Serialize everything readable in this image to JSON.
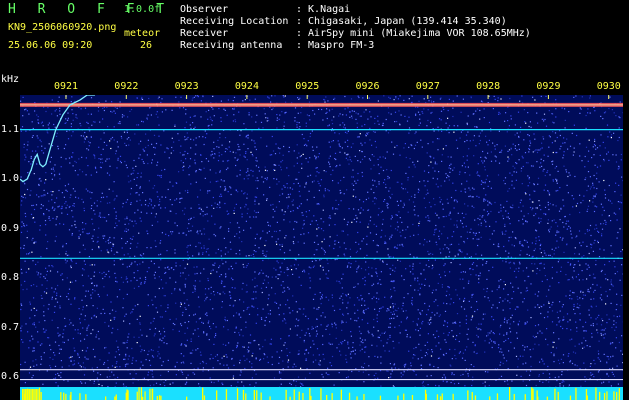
{
  "header": {
    "brand": "H R O F F T",
    "version": "1.0.0f",
    "filename": "KN9_2506060920.png",
    "datetime": "25.06.06 09:20",
    "meteor_label": "meteor",
    "meteor_count": "26",
    "fields": [
      {
        "label": "Observer",
        "value": ": K.Nagai"
      },
      {
        "label": "Receiving Location",
        "value": ": Chigasaki, Japan (139.414 35.340)"
      },
      {
        "label": "Receiver",
        "value": ": AirSpy mini (Miakejima VOR 108.65MHz)"
      },
      {
        "label": "Receiving antenna",
        "value": ": Maspro FM-3"
      }
    ]
  },
  "chart_data": {
    "type": "heatmap",
    "ylabel": "kHz",
    "y_ticks": [
      "1.1",
      "1.0",
      "0.9",
      "0.8",
      "0.7",
      "0.6"
    ],
    "x_ticks": [
      "0921",
      "0922",
      "0923",
      "0924",
      "0925",
      "0926",
      "0927",
      "0928",
      "0929",
      "0930"
    ],
    "ylim": [
      0.58,
      1.17
    ],
    "horizontal_lines_khz": [
      1.15,
      1.1,
      0.84,
      0.615,
      0.595
    ],
    "trace_points": [
      [
        0.0,
        1.0
      ],
      [
        0.02,
        0.995
      ],
      [
        0.05,
        1.0
      ],
      [
        0.08,
        1.02
      ],
      [
        0.1,
        1.04
      ],
      [
        0.12,
        1.05
      ],
      [
        0.14,
        1.03
      ],
      [
        0.16,
        1.025
      ],
      [
        0.18,
        1.03
      ],
      [
        0.21,
        1.06
      ],
      [
        0.25,
        1.1
      ],
      [
        0.3,
        1.13
      ],
      [
        0.35,
        1.15
      ],
      [
        0.42,
        1.16
      ],
      [
        0.47,
        1.17
      ],
      [
        0.52,
        1.17
      ],
      [
        0.56,
        1.19
      ]
    ],
    "colors": {
      "background": "#000c5a",
      "noise": "#4455ff",
      "line_hot": "#ff5a5a",
      "line_cyan": "#1ae0ff",
      "floor": "#1ae0ff",
      "spikes": "#ffff00"
    }
  }
}
